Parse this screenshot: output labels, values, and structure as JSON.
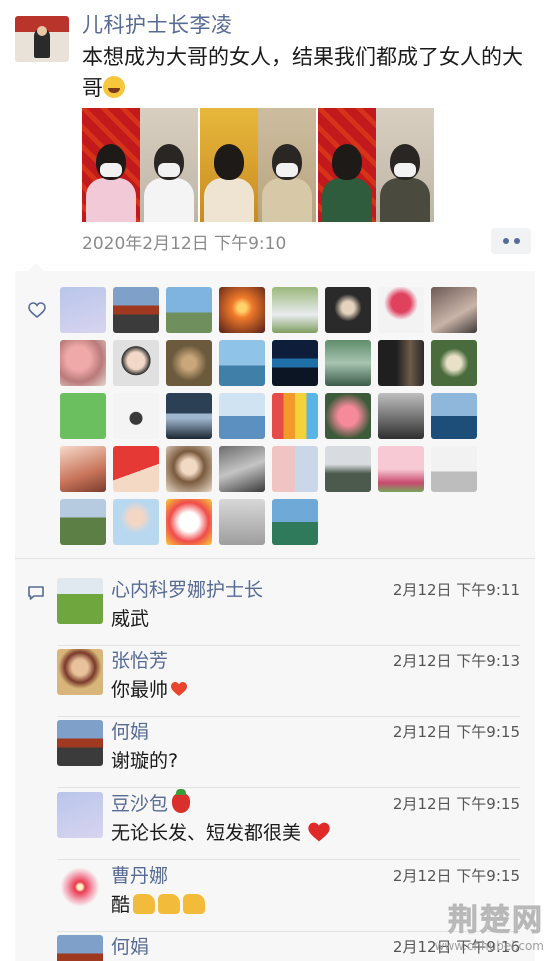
{
  "post": {
    "author": "儿科护士长李凌",
    "text": "本想成为大哥的女人，结果我们都成了女人的大哥",
    "time": "2020年2月12日  下午9:10"
  },
  "comments": [
    {
      "name": "心内科罗娜护士长",
      "time": "2月12日 下午9:11",
      "text": "威武"
    },
    {
      "name": "张怡芳",
      "time": "2月12日 下午9:13",
      "text": "你最帅"
    },
    {
      "name": "何娟",
      "time": "2月12日 下午9:15",
      "text": "谢璇的?"
    },
    {
      "name": "豆沙包",
      "time": "2月12日 下午9:15",
      "text": "无论长发、短发都很美"
    },
    {
      "name": "曹丹娜",
      "time": "2月12日 下午9:15",
      "text": "酷"
    },
    {
      "name": "何娟",
      "time": "2月12日 下午9:16",
      "text": ""
    }
  ],
  "watermark": {
    "main": "荆楚网",
    "sub": "www.cnhubei.com"
  },
  "colors": {
    "link": "#576b95",
    "box": "#f7f7f7"
  }
}
